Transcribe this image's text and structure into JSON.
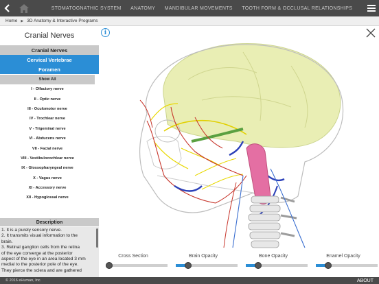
{
  "topnav": {
    "items": [
      "STOMATOGNATHIC SYSTEM",
      "ANATOMY",
      "MANDIBULAR MOVEMENTS",
      "TOOTH FORM & OCCLUSAL RELATIONSHIPS"
    ]
  },
  "breadcrumb": {
    "home": "Home",
    "section": "3D Anatomy & Interactive Programs"
  },
  "sidebar": {
    "title": "Cranial Nerves",
    "categories": [
      "Cranial Nerves",
      "Cervical Vertebrae",
      "Foramen"
    ],
    "show_all": "Show All",
    "nerves": [
      "I - Olfactory nerve",
      "II - Optic nerve",
      "III - Oculomotor nerve",
      "IV - Trochlear nerve",
      "V - Trigeminal nerve",
      "VI - Abducens nerve",
      "VII - Facial nerve",
      "VIII - Vestibulocochlear nerve",
      "IX - Glossopharyngeal nerve",
      "X - Vagus nerve",
      "XI - Accessory nerve",
      "XII - Hypoglossal nerve"
    ]
  },
  "description": {
    "header": "Description",
    "lines": [
      "1.  It is a purely sensory nerve.",
      "2.  It transmits visual information to the",
      "brain.",
      "3.  Retinal ganglion cells from the retina",
      "of the eye converge at the posterior",
      "aspect of the eye in an area located 3 mm",
      "medial to the posterior pole of the eye.",
      "They pierce the sclera and are gathered"
    ]
  },
  "info_glyph": "i",
  "controls": {
    "sliders": [
      {
        "label": "Cross Section",
        "value": 0.0
      },
      {
        "label": "Brain Opacity",
        "value": 0.15
      },
      {
        "label": "Bone Opacity",
        "value": 0.15
      },
      {
        "label": "Enamel Opacity",
        "value": 0.15
      }
    ]
  },
  "footer": {
    "copyright": "© 2016 eHuman, Inc.",
    "about": "ABOUT"
  },
  "colors": {
    "accent": "#2b8ed6",
    "topbar": "#4a4a4a"
  },
  "icons": [
    "back-chevron-icon",
    "home-icon",
    "menu-icon",
    "info-icon",
    "close-icon",
    "breadcrumb-arrow-icon"
  ]
}
